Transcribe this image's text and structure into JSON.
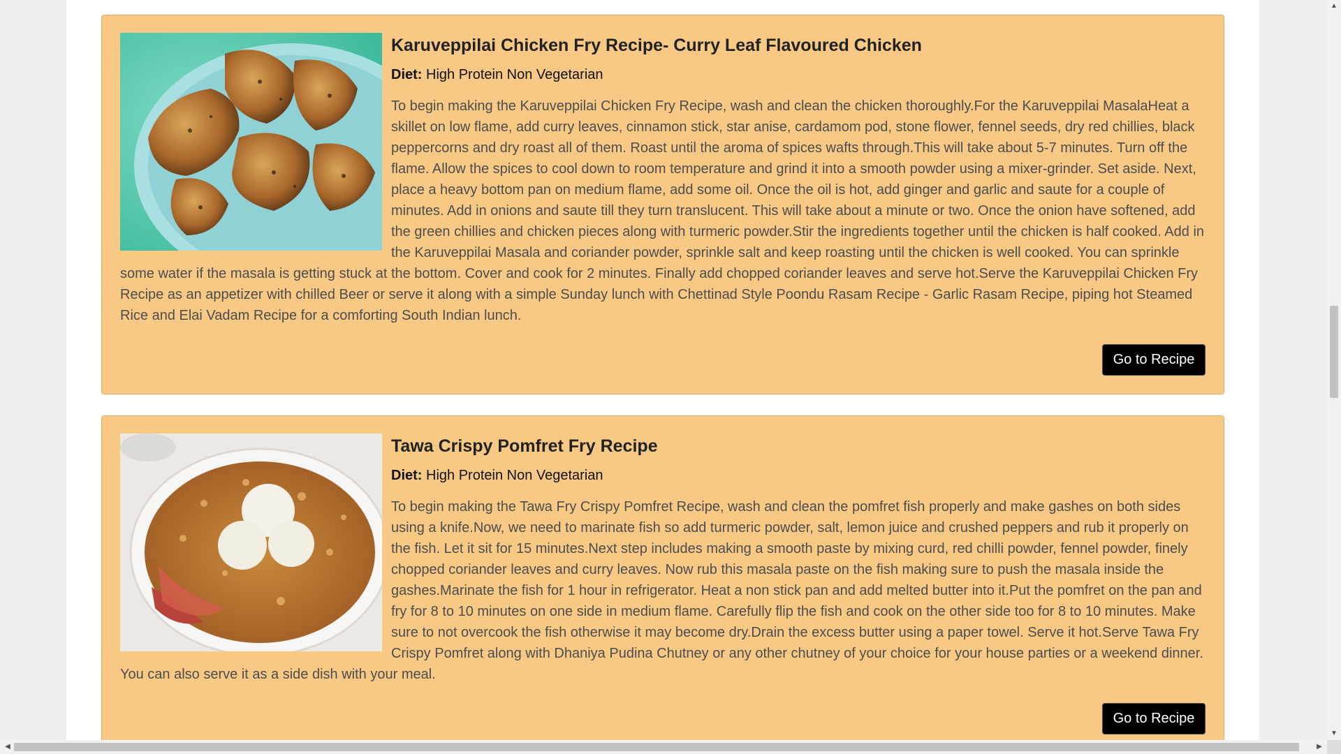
{
  "recipes": [
    {
      "title": "Karuveppilai Chicken Fry Recipe- Curry Leaf Flavoured Chicken",
      "diet_label": "Diet:",
      "diet": "High Protein Non Vegetarian",
      "description": "To begin making the Karuveppilai Chicken Fry Recipe, wash and clean the chicken thoroughly.For the Karuveppilai MasalaHeat a skillet on low flame, add curry leaves,  cinnamon stick, star anise, cardamom pod, stone flower, fennel seeds, dry red chillies, black peppercorns and dry roast all of them. Roast until the aroma of spices wafts through.This will take about 5-7 minutes. Turn off the flame. Allow the spices to cool down to room temperature and grind it into a smooth powder using a mixer-grinder. Set aside. Next, place a heavy bottom pan on medium flame, add some oil. Once the oil is hot, add ginger and garlic and saute for a couple of minutes. Add in onions and saute till they turn translucent. This will take about a minute or two.  Once the onion have softened, add the green chillies and chicken pieces along with turmeric powder.Stir the ingredients together until the chicken is half cooked. Add in the Karuveppilai Masala and coriander powder, sprinkle salt and keep roasting until the chicken is well cooked. You can sprinkle some water if the masala is getting stuck at the bottom. Cover and cook for 2 minutes. Finally add chopped coriander leaves and serve hot.Serve the Karuveppilai Chicken Fry Recipe as an appetizer with chilled Beer or serve it along with a simple Sunday lunch with Chettinad Style Poondu Rasam Recipe - Garlic Rasam Recipe, piping hot Steamed Rice  and Elai Vadam Recipe for a comforting South Indian lunch.",
      "button_label": "Go to Recipe"
    },
    {
      "title": "Tawa Crispy Pomfret Fry Recipe",
      "diet_label": "Diet:",
      "diet": "High Protein Non Vegetarian",
      "description": "To begin making the Tawa Fry Crispy Pomfret Recipe, wash and clean the pomfret fish properly and make gashes on both sides using a knife.Now, we need to marinate fish so add turmeric powder, salt, lemon juice and crushed peppers and rub it properly on the fish. Let it sit for 15 minutes.Next step includes making a smooth paste by mixing curd, red chilli powder, fennel powder, finely chopped coriander leaves and curry leaves. Now rub this masala paste on the fish making sure to push the masala inside the gashes.Marinate the fish for 1 hour in refrigerator. Heat a non stick pan and add melted butter into it.Put the pomfret on the pan and fry for 8 to 10 minutes on one side in medium flame. Carefully flip the fish and cook on the other side too for 8 to 10 minutes. Make sure to not overcook the fish otherwise it may become dry.Drain the excess butter using a paper towel. Serve it hot.Serve Tawa Fry Crispy Pomfret along with Dhaniya Pudina Chutney or any other chutney of your choice for your house parties or a weekend dinner. You can also serve it as a side dish with your meal.",
      "button_label": "Go to Recipe"
    }
  ],
  "colors": {
    "card_bg": "#f8c885",
    "card_border": "#e8ad62",
    "button_bg": "#000000",
    "button_text": "#ffffff"
  },
  "icons": {
    "scroll_up": "scroll-up-arrow-icon",
    "scroll_down": "scroll-down-arrow-icon",
    "scroll_left": "scroll-left-arrow-icon",
    "scroll_right": "scroll-right-arrow-icon"
  }
}
